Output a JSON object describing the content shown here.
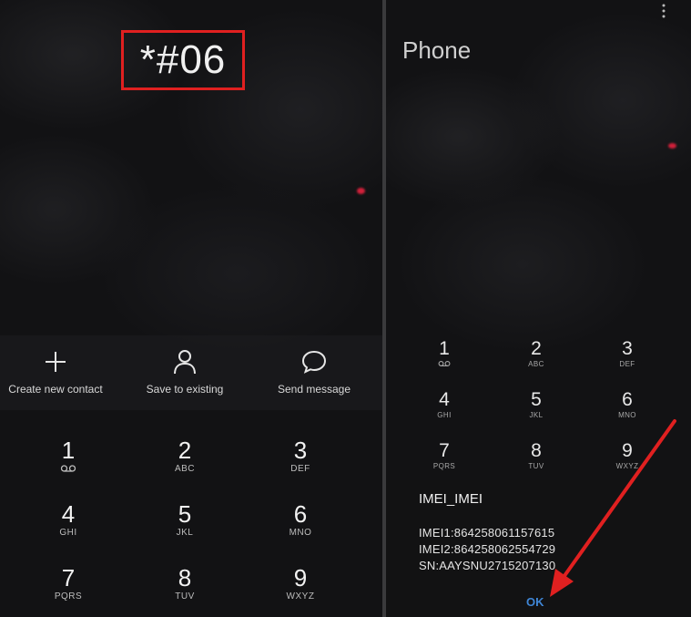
{
  "left": {
    "dialed_number": "*#06",
    "actions": [
      {
        "label": "Create new contact",
        "icon": "plus-icon"
      },
      {
        "label": "Save to existing",
        "icon": "person-icon"
      },
      {
        "label": "Send message",
        "icon": "chat-bubble-icon"
      }
    ],
    "keypad": [
      {
        "num": "1",
        "sub": ""
      },
      {
        "num": "2",
        "sub": "ABC"
      },
      {
        "num": "3",
        "sub": "DEF"
      },
      {
        "num": "4",
        "sub": "GHI"
      },
      {
        "num": "5",
        "sub": "JKL"
      },
      {
        "num": "6",
        "sub": "MNO"
      },
      {
        "num": "7",
        "sub": "PQRS"
      },
      {
        "num": "8",
        "sub": "TUV"
      },
      {
        "num": "9",
        "sub": "WXYZ"
      }
    ]
  },
  "right": {
    "title": "Phone",
    "keypad": [
      {
        "num": "1",
        "sub": ""
      },
      {
        "num": "2",
        "sub": "ABC"
      },
      {
        "num": "3",
        "sub": "DEF"
      },
      {
        "num": "4",
        "sub": "GHI"
      },
      {
        "num": "5",
        "sub": "JKL"
      },
      {
        "num": "6",
        "sub": "MNO"
      },
      {
        "num": "7",
        "sub": "PQRS"
      },
      {
        "num": "8",
        "sub": "TUV"
      },
      {
        "num": "9",
        "sub": "WXYZ"
      }
    ],
    "dialog": {
      "title": "IMEI_IMEI",
      "lines": [
        "IMEI1:864258061157615",
        "IMEI2:864258062554729",
        "SN:AAYSNU2715207130"
      ],
      "ok_label": "OK"
    }
  },
  "colors": {
    "highlight_box": "#e02020",
    "arrow": "#e02020",
    "ok_button": "#3f86d6"
  }
}
